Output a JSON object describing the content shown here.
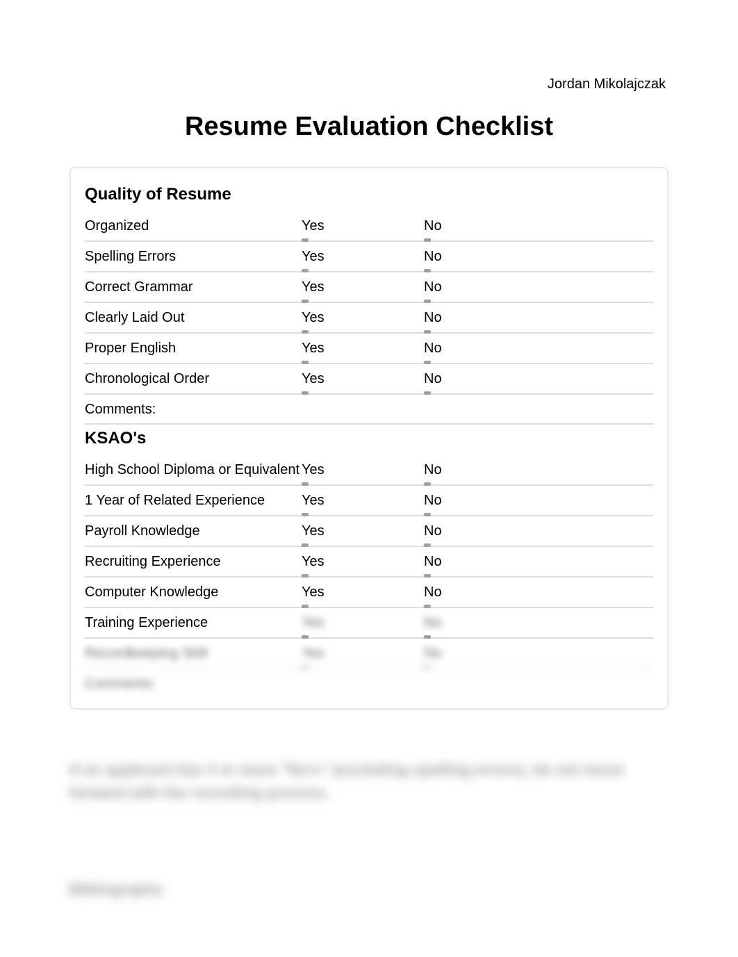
{
  "author": "Jordan Mikolajczak",
  "title": "Resume Evaluation Checklist",
  "yes": "Yes",
  "no": "No",
  "comments_label": "Comments:",
  "sections": {
    "quality": {
      "heading": "Quality of Resume",
      "items": [
        "Organized",
        "Spelling Errors",
        "Correct Grammar",
        "Clearly Laid Out",
        "Proper English",
        "Chronological Order"
      ]
    },
    "ksao": {
      "heading": "KSAO's",
      "items": [
        "High School Diploma or Equivalent",
        "1 Year of Related Experience",
        "Payroll Knowledge",
        "Recruiting Experience",
        "Computer Knowledge",
        "Training Experience",
        "Recordkeeping Skill"
      ]
    }
  },
  "footer_note_line1": "If an applicant has 3 or more \"No's\" (excluding spelling errors), do not move",
  "footer_note_line2": "forward with the recruiting process.",
  "bibliography": "Bibliography"
}
